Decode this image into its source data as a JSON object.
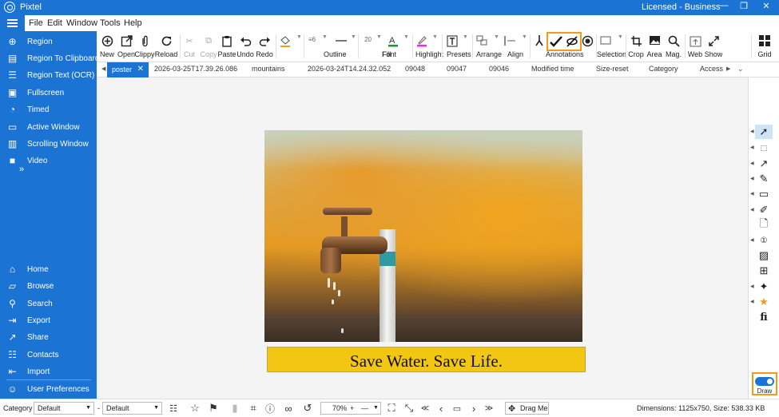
{
  "app": {
    "title": "Pixtel",
    "license": "Licensed - Business"
  },
  "window_controls": {
    "minimize": "—",
    "restore": "❐",
    "close": "✕"
  },
  "menu": [
    "File",
    "Edit",
    "Window",
    "Tools",
    "Help"
  ],
  "sidebar": {
    "top_items": [
      {
        "label": "Region",
        "icon": "crosshair-icon"
      },
      {
        "label": "Region To Clipboard",
        "icon": "clipboard-capture-icon"
      },
      {
        "label": "Region Text (OCR)",
        "icon": "ocr-text-icon"
      },
      {
        "label": "Fullscreen",
        "icon": "fullscreen-icon"
      },
      {
        "label": "Timed",
        "icon": "timer-icon"
      },
      {
        "label": "Active Window",
        "icon": "window-icon"
      },
      {
        "label": "Scrolling Window",
        "icon": "scroll-window-icon"
      },
      {
        "label": "Video",
        "icon": "video-icon"
      }
    ],
    "more": "»",
    "bottom_items": [
      {
        "label": "Home",
        "icon": "home-icon"
      },
      {
        "label": "Browse",
        "icon": "browse-icon"
      },
      {
        "label": "Search",
        "icon": "search-icon"
      },
      {
        "label": "Export",
        "icon": "export-icon"
      },
      {
        "label": "Share",
        "icon": "share-icon"
      },
      {
        "label": "Contacts",
        "icon": "contacts-icon"
      },
      {
        "label": "Import",
        "icon": "import-icon"
      },
      {
        "label": "User Preferences",
        "icon": "user-icon"
      }
    ]
  },
  "toolbar": {
    "file_buttons": [
      "New",
      "Open",
      "Clippy",
      "Reload"
    ],
    "edit_buttons": [
      "Cut",
      "Copy",
      "Paste",
      "Undo",
      "Redo"
    ],
    "fill": "Fill",
    "outline": "Outline",
    "outline_width": "6",
    "font": "Font",
    "font_size": "20",
    "highlight": "Highlight",
    "presets": "Presets",
    "arrange": "Arrange",
    "align": "Align",
    "annotations": "Annotations",
    "selection": "Selection",
    "view_buttons": [
      "Crop",
      "Area",
      "Mag.",
      "Web",
      "Show"
    ],
    "grid": "Grid"
  },
  "tabs": {
    "active": "poster",
    "items": [
      "2026-03-25T17.39.26.086",
      "mountains",
      "2026-03-24T14.24.32.052",
      "09048",
      "09047",
      "09046",
      "Modified time",
      "Size-reset",
      "Category",
      "Access"
    ]
  },
  "canvas": {
    "banner_text": "Save Water. Save Life."
  },
  "right_tools": {
    "draw_label": "Draw"
  },
  "statusbar": {
    "category_label": "Category",
    "category_value": "Default",
    "second_value": "Default",
    "zoom": "70%",
    "drag_label": "Drag Me",
    "dimensions": "Dimensions: 1125x750, Size: 538.33 KB"
  },
  "colors": {
    "accent": "#1b74d4",
    "highlight_box": "#f29a1c",
    "banner": "#f3c613"
  }
}
